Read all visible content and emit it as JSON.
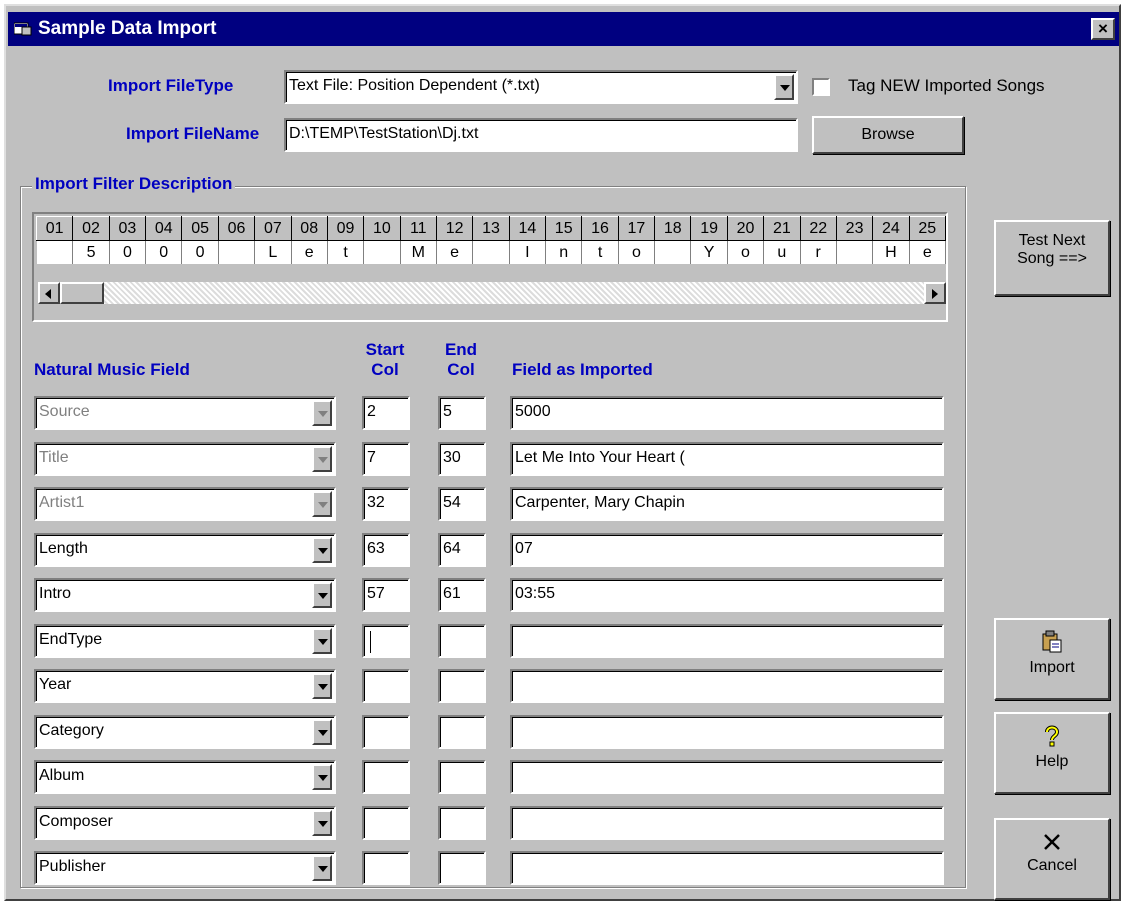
{
  "window": {
    "title": "Sample Data Import",
    "close_label": "×"
  },
  "import_filetype": {
    "label": "Import FileType",
    "value": "Text File: Position Dependent  (*.txt)"
  },
  "tag_new": {
    "label": "Tag NEW Imported Songs",
    "checked": false
  },
  "import_filename": {
    "label": "Import FileName",
    "value": "D:\\TEMP\\TestStation\\Dj.txt"
  },
  "browse_button": {
    "label": "Browse"
  },
  "filter": {
    "legend": "Import Filter Description",
    "columns": [
      "01",
      "02",
      "03",
      "04",
      "05",
      "06",
      "07",
      "08",
      "09",
      "10",
      "11",
      "12",
      "13",
      "14",
      "15",
      "16",
      "17",
      "18",
      "19",
      "20",
      "21",
      "22",
      "23",
      "24",
      "25"
    ],
    "chars": [
      "",
      "5",
      "0",
      "0",
      "0",
      "",
      "L",
      "e",
      "t",
      "",
      "M",
      "e",
      "",
      "I",
      "n",
      "t",
      "o",
      "",
      "Y",
      "o",
      "u",
      "r",
      "",
      "H",
      "e"
    ]
  },
  "table_headers": {
    "field": "Natural Music Field",
    "start_line1": "Start",
    "start_line2": "Col",
    "end_line1": "End",
    "end_line2": "Col",
    "imported": "Field as Imported"
  },
  "rows": [
    {
      "field": "Source",
      "disabled": true,
      "start": "2",
      "end": "5",
      "imported": "5000"
    },
    {
      "field": "Title",
      "disabled": true,
      "start": "7",
      "end": "30",
      "imported": "Let Me Into Your Heart ("
    },
    {
      "field": "Artist1",
      "disabled": true,
      "start": "32",
      "end": "54",
      "imported": "Carpenter, Mary Chapin"
    },
    {
      "field": "Length",
      "disabled": false,
      "start": "63",
      "end": "64",
      "imported": "07"
    },
    {
      "field": "Intro",
      "disabled": false,
      "start": "57",
      "end": "61",
      "imported": "03:55"
    },
    {
      "field": "EndType",
      "disabled": false,
      "start": "",
      "end": "",
      "imported": ""
    },
    {
      "field": "Year",
      "disabled": false,
      "start": "",
      "end": "",
      "imported": ""
    },
    {
      "field": "Category",
      "disabled": false,
      "start": "",
      "end": "",
      "imported": ""
    },
    {
      "field": "Album",
      "disabled": false,
      "start": "",
      "end": "",
      "imported": ""
    },
    {
      "field": "Composer",
      "disabled": false,
      "start": "",
      "end": "",
      "imported": ""
    },
    {
      "field": "Publisher",
      "disabled": false,
      "start": "",
      "end": "",
      "imported": ""
    }
  ],
  "buttons": {
    "test_next_line1": "Test Next",
    "test_next_line2": "Song ==>",
    "import": "Import",
    "help": "Help",
    "cancel": "Cancel"
  },
  "icons": {
    "app": "app-window-icon",
    "import": "clipboard-icon",
    "help": "question-icon",
    "cancel": "x-icon"
  },
  "colors": {
    "title_bar": "#000080",
    "label_blue": "#0000c0",
    "face": "#c0c0c0"
  }
}
